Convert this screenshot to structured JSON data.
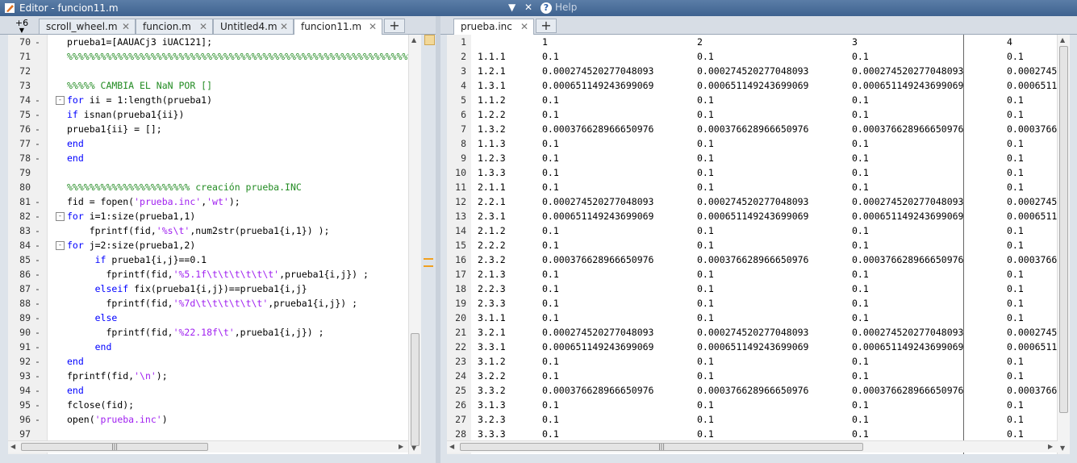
{
  "window": {
    "title": "Editor - funcion11.m",
    "help_label": "Help"
  },
  "left": {
    "overflow_label": "+6",
    "tabs": [
      {
        "label": "scroll_wheel.m"
      },
      {
        "label": "funcion.m"
      },
      {
        "label": "Untitled4.m"
      },
      {
        "label": "funcion11.m",
        "active": true
      }
    ],
    "lines": [
      {
        "n": "70",
        "d": "-",
        "t": "prueba1=[AAUACj3 iUAC121];",
        "c": ""
      },
      {
        "n": "71",
        "d": "",
        "t": "%%%%%%%%%%%%%%%%%%%%%%%%%%%%%%%%%%%%%%%%%%%%%%%%%%%%%%%%%%%%%%",
        "c": "cm"
      },
      {
        "n": "72",
        "d": "",
        "t": "",
        "c": ""
      },
      {
        "n": "73",
        "d": "",
        "t": "%%%%% CAMBIA EL NaN POR []",
        "c": "cm"
      },
      {
        "n": "74",
        "d": "-",
        "t": "for ii = 1:length(prueba1)",
        "c": "",
        "fold": "-"
      },
      {
        "n": "75",
        "d": "-",
        "t": "if isnan(prueba1{ii})",
        "c": ""
      },
      {
        "n": "76",
        "d": "-",
        "t": "prueba1{ii} = [];",
        "c": ""
      },
      {
        "n": "77",
        "d": "-",
        "t": "end",
        "c": "kw"
      },
      {
        "n": "78",
        "d": "-",
        "t": "end",
        "c": "kw"
      },
      {
        "n": "79",
        "d": "",
        "t": "",
        "c": ""
      },
      {
        "n": "80",
        "d": "",
        "t": "%%%%%%%%%%%%%%%%%%%%%% creación prueba.INC",
        "c": "cm"
      },
      {
        "n": "81",
        "d": "-",
        "t": "fid = fopen('prueba.inc','wt');",
        "c": ""
      },
      {
        "n": "82",
        "d": "-",
        "t": "for i=1:size(prueba1,1)",
        "c": "",
        "fold": "-"
      },
      {
        "n": "83",
        "d": "-",
        "t": "    fprintf(fid,'%s\\t',num2str(prueba1{i,1}) );",
        "c": ""
      },
      {
        "n": "84",
        "d": "-",
        "t": "for j=2:size(prueba1,2)",
        "c": "",
        "fold": "-"
      },
      {
        "n": "85",
        "d": "-",
        "t": "     if prueba1{i,j}==0.1",
        "c": ""
      },
      {
        "n": "86",
        "d": "-",
        "t": "       fprintf(fid,'%5.1f\\t\\t\\t\\t\\t\\t',prueba1{i,j}) ;",
        "c": ""
      },
      {
        "n": "87",
        "d": "-",
        "t": "     elseif fix(prueba1{i,j})==prueba1{i,j}",
        "c": ""
      },
      {
        "n": "88",
        "d": "-",
        "t": "       fprintf(fid,'%7d\\t\\t\\t\\t\\t\\t',prueba1{i,j}) ;",
        "c": ""
      },
      {
        "n": "89",
        "d": "-",
        "t": "     else",
        "c": "kw"
      },
      {
        "n": "90",
        "d": "-",
        "t": "       fprintf(fid,'%22.18f\\t',prueba1{i,j}) ;",
        "c": ""
      },
      {
        "n": "91",
        "d": "-",
        "t": "     end",
        "c": "kw"
      },
      {
        "n": "92",
        "d": "-",
        "t": "end",
        "c": "kw"
      },
      {
        "n": "93",
        "d": "-",
        "t": "fprintf(fid,'\\n');",
        "c": ""
      },
      {
        "n": "94",
        "d": "-",
        "t": "end",
        "c": "kw"
      },
      {
        "n": "95",
        "d": "-",
        "t": "fclose(fid);",
        "c": ""
      },
      {
        "n": "96",
        "d": "-",
        "t": "open('prueba.inc')",
        "c": ""
      },
      {
        "n": "97",
        "d": "",
        "t": "",
        "c": ""
      }
    ]
  },
  "right": {
    "tabs": [
      {
        "label": "prueba.inc",
        "active": true
      }
    ],
    "rows": [
      [
        "1",
        "",
        "1",
        "2",
        "3",
        "4"
      ],
      [
        "2",
        "1.1.1",
        "0.1",
        "0.1",
        "0.1",
        "0.1"
      ],
      [
        "3",
        "1.2.1",
        "0.000274520277048093",
        "0.000274520277048093",
        "0.000274520277048093",
        "0.0002745"
      ],
      [
        "4",
        "1.3.1",
        "0.000651149243699069",
        "0.000651149243699069",
        "0.000651149243699069",
        "0.0006511"
      ],
      [
        "5",
        "1.1.2",
        "0.1",
        "0.1",
        "0.1",
        "0.1"
      ],
      [
        "6",
        "1.2.2",
        "0.1",
        "0.1",
        "0.1",
        "0.1"
      ],
      [
        "7",
        "1.3.2",
        "0.000376628966650976",
        "0.000376628966650976",
        "0.000376628966650976",
        "0.0003766"
      ],
      [
        "8",
        "1.1.3",
        "0.1",
        "0.1",
        "0.1",
        "0.1"
      ],
      [
        "9",
        "1.2.3",
        "0.1",
        "0.1",
        "0.1",
        "0.1"
      ],
      [
        "10",
        "1.3.3",
        "0.1",
        "0.1",
        "0.1",
        "0.1"
      ],
      [
        "11",
        "2.1.1",
        "0.1",
        "0.1",
        "0.1",
        "0.1"
      ],
      [
        "12",
        "2.2.1",
        "0.000274520277048093",
        "0.000274520277048093",
        "0.000274520277048093",
        "0.0002745"
      ],
      [
        "13",
        "2.3.1",
        "0.000651149243699069",
        "0.000651149243699069",
        "0.000651149243699069",
        "0.0006511"
      ],
      [
        "14",
        "2.1.2",
        "0.1",
        "0.1",
        "0.1",
        "0.1"
      ],
      [
        "15",
        "2.2.2",
        "0.1",
        "0.1",
        "0.1",
        "0.1"
      ],
      [
        "16",
        "2.3.2",
        "0.000376628966650976",
        "0.000376628966650976",
        "0.000376628966650976",
        "0.0003766"
      ],
      [
        "17",
        "2.1.3",
        "0.1",
        "0.1",
        "0.1",
        "0.1"
      ],
      [
        "18",
        "2.2.3",
        "0.1",
        "0.1",
        "0.1",
        "0.1"
      ],
      [
        "19",
        "2.3.3",
        "0.1",
        "0.1",
        "0.1",
        "0.1"
      ],
      [
        "20",
        "3.1.1",
        "0.1",
        "0.1",
        "0.1",
        "0.1"
      ],
      [
        "21",
        "3.2.1",
        "0.000274520277048093",
        "0.000274520277048093",
        "0.000274520277048093",
        "0.0002745"
      ],
      [
        "22",
        "3.3.1",
        "0.000651149243699069",
        "0.000651149243699069",
        "0.000651149243699069",
        "0.0006511"
      ],
      [
        "23",
        "3.1.2",
        "0.1",
        "0.1",
        "0.1",
        "0.1"
      ],
      [
        "24",
        "3.2.2",
        "0.1",
        "0.1",
        "0.1",
        "0.1"
      ],
      [
        "25",
        "3.3.2",
        "0.000376628966650976",
        "0.000376628966650976",
        "0.000376628966650976",
        "0.0003766"
      ],
      [
        "26",
        "3.1.3",
        "0.1",
        "0.1",
        "0.1",
        "0.1"
      ],
      [
        "27",
        "3.2.3",
        "0.1",
        "0.1",
        "0.1",
        "0.1"
      ],
      [
        "28",
        "3.3.3",
        "0.1",
        "0.1",
        "0.1",
        "0.1"
      ]
    ]
  }
}
